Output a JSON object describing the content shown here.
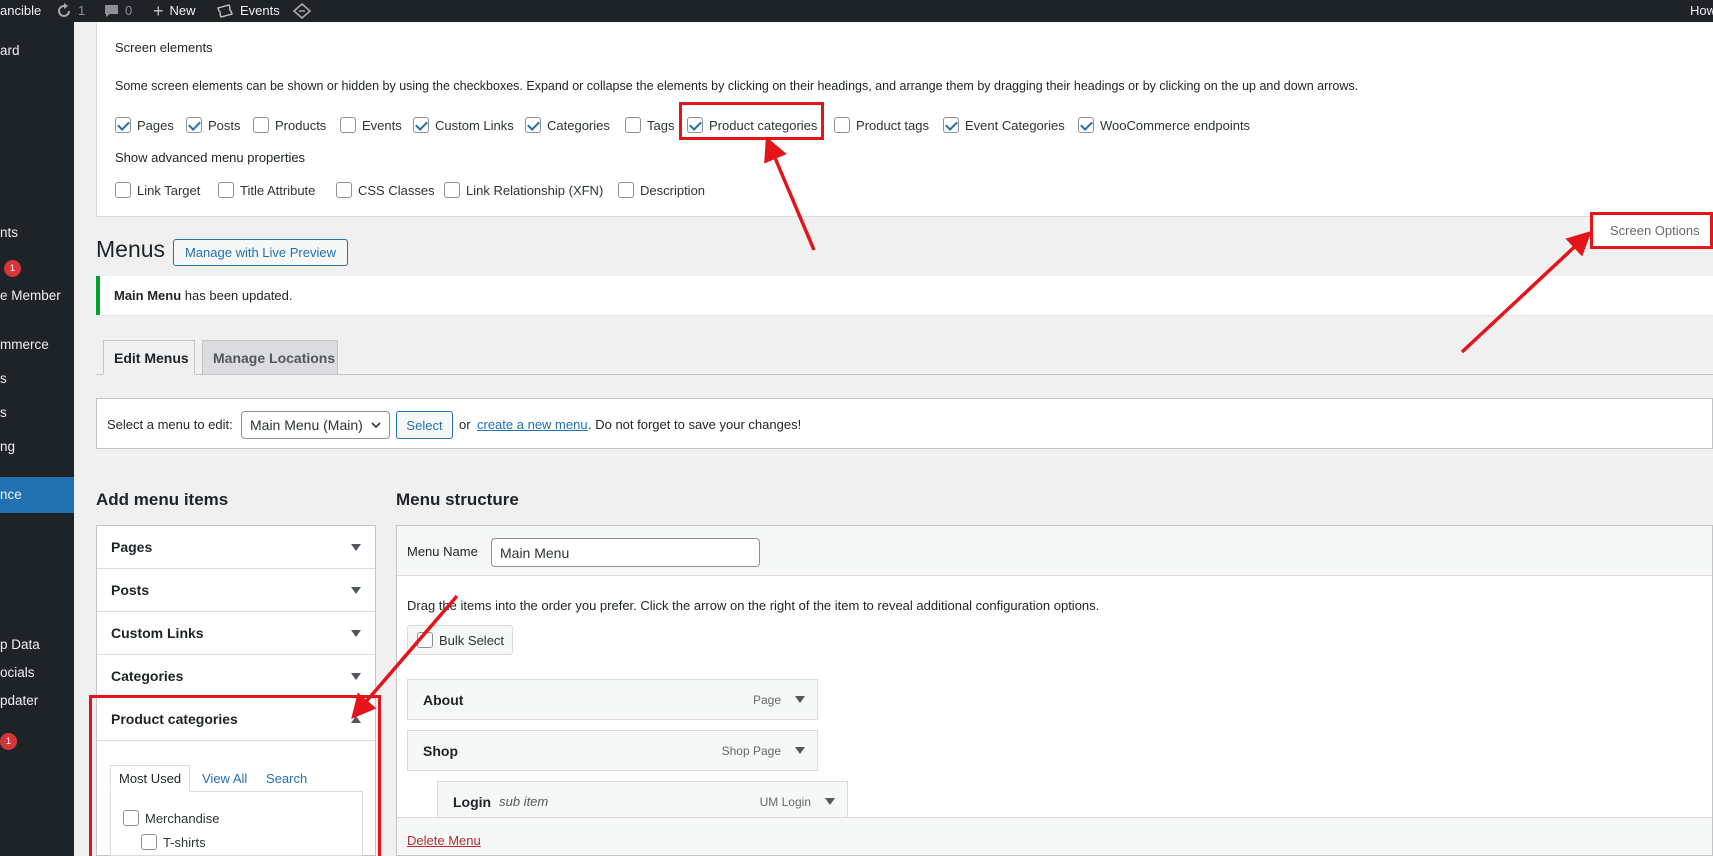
{
  "adminbar": {
    "site_name": "ancible",
    "updates_count": "1",
    "comments_count": "0",
    "new_label": "New",
    "events_label": "Events",
    "howdy": "How"
  },
  "sidebar": {
    "items": [
      {
        "label": "ard"
      },
      {
        "label": "nts"
      },
      {
        "label": "e Member"
      },
      {
        "label": "mmerce"
      },
      {
        "label": "s"
      },
      {
        "label": "s"
      },
      {
        "label": "ng"
      },
      {
        "label": "nce"
      },
      {
        "label": "p Data"
      },
      {
        "label": "ocials"
      },
      {
        "label": "pdater"
      }
    ],
    "badge_1": "1",
    "badge_2": "1"
  },
  "screen_meta": {
    "heading": "Screen elements",
    "description": "Some screen elements can be shown or hidden by using the checkboxes. Expand or collapse the elements by clicking on their headings, and arrange them by dragging their headings or by clicking on the up and down arrows.",
    "elements": [
      {
        "label": "Pages",
        "checked": true
      },
      {
        "label": "Posts",
        "checked": true
      },
      {
        "label": "Products",
        "checked": false
      },
      {
        "label": "Events",
        "checked": false
      },
      {
        "label": "Custom Links",
        "checked": true
      },
      {
        "label": "Categories",
        "checked": true
      },
      {
        "label": "Tags",
        "checked": false
      },
      {
        "label": "Product categories",
        "checked": true
      },
      {
        "label": "Product tags",
        "checked": false
      },
      {
        "label": "Event Categories",
        "checked": true
      },
      {
        "label": "WooCommerce endpoints",
        "checked": true
      }
    ],
    "advanced_heading": "Show advanced menu properties",
    "advanced": [
      {
        "label": "Link Target",
        "checked": false
      },
      {
        "label": "Title Attribute",
        "checked": false
      },
      {
        "label": "CSS Classes",
        "checked": false
      },
      {
        "label": "Link Relationship (XFN)",
        "checked": false
      },
      {
        "label": "Description",
        "checked": false
      }
    ]
  },
  "screen_options_label": "Screen Options",
  "page": {
    "title": "Menus",
    "live_preview": "Manage with Live Preview",
    "notice_bold": "Main Menu",
    "notice_rest": " has been updated."
  },
  "tabs": {
    "edit": "Edit Menus",
    "locations": "Manage Locations"
  },
  "select_menu": {
    "label": "Select a menu to edit:",
    "value": "Main Menu (Main)",
    "button": "Select",
    "or": "or",
    "create_link": "create a new menu",
    "tail": ". Do not forget to save your changes!"
  },
  "add_items": {
    "heading": "Add menu items",
    "sections": [
      "Pages",
      "Posts",
      "Custom Links",
      "Categories",
      "Product categories"
    ],
    "subtabs": [
      "Most Used",
      "View All",
      "Search"
    ],
    "list": [
      {
        "label": "Merchandise",
        "checked": false
      },
      {
        "label": "T-shirts",
        "checked": false
      }
    ]
  },
  "structure": {
    "heading": "Menu structure",
    "name_label": "Menu Name",
    "name_value": "Main Menu",
    "instructions": "Drag the items into the order you prefer. Click the arrow on the right of the item to reveal additional configuration options.",
    "bulk_select": "Bulk Select",
    "items": [
      {
        "title": "About",
        "type": "Page",
        "sub": ""
      },
      {
        "title": "Shop",
        "type": "Shop Page",
        "sub": ""
      },
      {
        "title": "Login",
        "type": "UM Login",
        "sub": "sub item"
      }
    ],
    "delete_label": "Delete Menu"
  },
  "colors": {
    "highlight": "#e4141b",
    "wp_blue": "#2271b1",
    "admin_dark": "#1d2327",
    "notice_green": "#00a32a"
  }
}
